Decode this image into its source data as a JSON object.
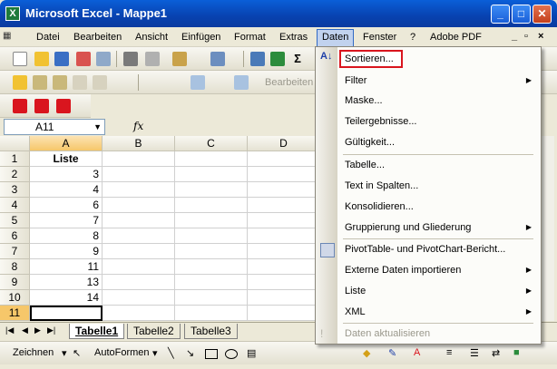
{
  "window": {
    "title": "Microsoft Excel - Mappe1",
    "app_icon": "X"
  },
  "menubar": {
    "items": [
      "Datei",
      "Bearbeiten",
      "Ansicht",
      "Einfügen",
      "Format",
      "Extras",
      "Daten",
      "Fenster",
      "?",
      "Adobe PDF"
    ],
    "active": "Daten"
  },
  "formula_bar": {
    "name_box": "A11",
    "fx": "fx"
  },
  "toolbar3": {
    "label": "Bearbeiten"
  },
  "sheet": {
    "columns": [
      "A",
      "B",
      "C",
      "D"
    ],
    "rows": [
      "1",
      "2",
      "3",
      "4",
      "5",
      "6",
      "7",
      "8",
      "9",
      "10",
      "11"
    ],
    "col_a_values": [
      "Liste",
      "3",
      "4",
      "6",
      "7",
      "8",
      "9",
      "11",
      "13",
      "14",
      ""
    ]
  },
  "tabs": [
    "Tabelle1",
    "Tabelle2",
    "Tabelle3"
  ],
  "drawbar": {
    "zeichnen": "Zeichnen",
    "autoformen": "AutoFormen"
  },
  "data_menu": {
    "items": [
      {
        "label": "Sortieren...",
        "highlight": true
      },
      {
        "label": "Filter",
        "submenu": true
      },
      {
        "label": "Maske..."
      },
      {
        "label": "Teilergebnisse..."
      },
      {
        "label": "Gültigkeit..."
      },
      {
        "label": "Tabelle..."
      },
      {
        "label": "Text in Spalten..."
      },
      {
        "label": "Konsolidieren..."
      },
      {
        "label": "Gruppierung und Gliederung",
        "submenu": true
      },
      {
        "label": "PivotTable- und PivotChart-Bericht..."
      },
      {
        "label": "Externe Daten importieren",
        "submenu": true
      },
      {
        "label": "Liste",
        "submenu": true
      },
      {
        "label": "XML",
        "submenu": true
      },
      {
        "label": "Daten aktualisieren",
        "disabled": true
      }
    ]
  },
  "colors": {
    "title_blue": "#0842b0",
    "highlight_red": "#d9151e",
    "selected_header": "#f6c76a"
  }
}
